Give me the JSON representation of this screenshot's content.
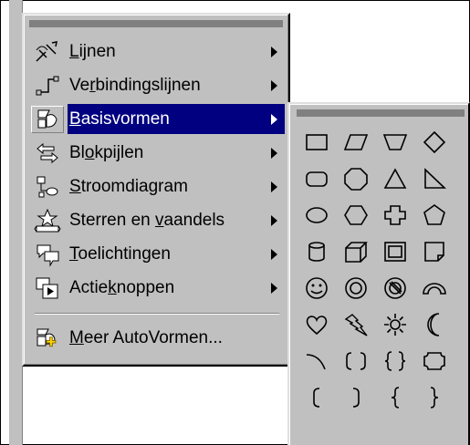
{
  "menu": {
    "items": [
      {
        "label_pre": "",
        "label_u": "L",
        "label_post": "ijnen",
        "icon": "lines-icon",
        "submenu": true
      },
      {
        "label_pre": "Ve",
        "label_u": "r",
        "label_post": "bindingslijnen",
        "icon": "connectors-icon",
        "submenu": true
      },
      {
        "label_pre": "",
        "label_u": "B",
        "label_post": "asisvormen",
        "icon": "basic-shapes-icon",
        "submenu": true,
        "selected": true
      },
      {
        "label_pre": "Bl",
        "label_u": "o",
        "label_post": "kpijlen",
        "icon": "block-arrows-icon",
        "submenu": true
      },
      {
        "label_pre": "",
        "label_u": "S",
        "label_post": "troomdiagram",
        "icon": "flowchart-icon",
        "submenu": true
      },
      {
        "label_pre": "Sterren en ",
        "label_u": "v",
        "label_post": "aandels",
        "icon": "stars-banners-icon",
        "submenu": true
      },
      {
        "label_pre": "",
        "label_u": "T",
        "label_post": "oelichtingen",
        "icon": "callouts-icon",
        "submenu": true
      },
      {
        "label_pre": "Actie",
        "label_u": "k",
        "label_post": "noppen",
        "icon": "action-buttons-icon",
        "submenu": true
      },
      {
        "label_pre": "",
        "label_u": "M",
        "label_post": "eer AutoVormen...",
        "icon": "more-autoshapes-icon",
        "submenu": false
      }
    ]
  },
  "submenu": {
    "shapes": [
      "rectangle-icon",
      "parallelogram-icon",
      "trapezoid-icon",
      "diamond-icon",
      "rounded-rectangle-icon",
      "octagon-icon",
      "triangle-icon",
      "right-triangle-icon",
      "oval-icon",
      "hexagon-icon",
      "cross-icon",
      "pentagon-icon",
      "can-icon",
      "cube-icon",
      "bevel-icon",
      "folded-corner-icon",
      "smiley-face-icon",
      "donut-icon",
      "no-symbol-icon",
      "block-arc-icon",
      "heart-icon",
      "lightning-bolt-icon",
      "sun-icon",
      "moon-icon",
      "arc-icon",
      "double-bracket-icon",
      "double-brace-icon",
      "plaque-icon",
      "left-bracket-icon",
      "right-bracket-icon",
      "left-brace-icon",
      "right-brace-icon"
    ]
  },
  "colors": {
    "menu_bg": "#c0c0c0",
    "highlight": "#000080"
  }
}
